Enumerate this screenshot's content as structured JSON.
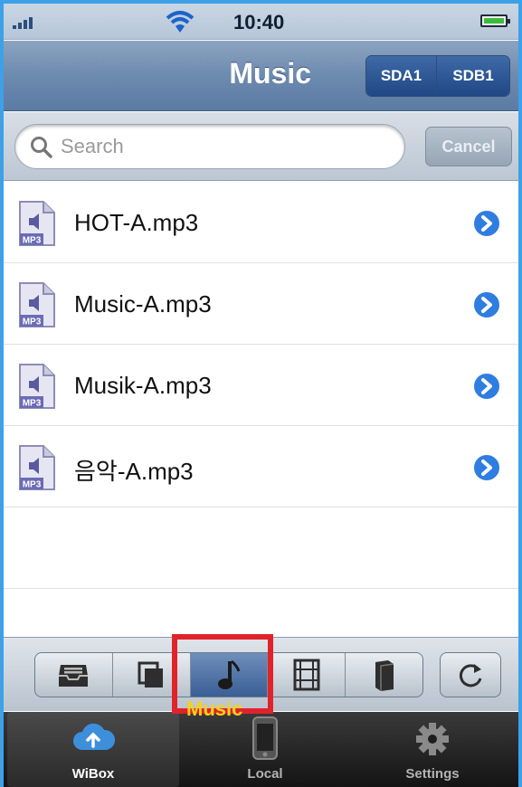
{
  "status_bar": {
    "time": "10:40"
  },
  "nav": {
    "title": "Music",
    "segments": [
      "SDA1",
      "SDB1"
    ]
  },
  "search": {
    "placeholder": "Search",
    "value": "",
    "cancel_label": "Cancel"
  },
  "files": [
    {
      "name": "HOT-A.mp3",
      "icon": "mp3-file-icon",
      "badge": "MP3"
    },
    {
      "name": "Music-A.mp3",
      "icon": "mp3-file-icon",
      "badge": "MP3"
    },
    {
      "name": "Musik-A.mp3",
      "icon": "mp3-file-icon",
      "badge": "MP3"
    },
    {
      "name": "음악-A.mp3",
      "icon": "mp3-file-icon",
      "badge": "MP3"
    }
  ],
  "toolbar": {
    "filters": [
      "inbox-icon",
      "documents-icon",
      "music-note-icon",
      "film-icon",
      "book-icon"
    ],
    "active_filter": "music-note-icon",
    "highlight_label": "Music",
    "highlight_color": "#e0232b"
  },
  "tabs": [
    {
      "label": "WiBox",
      "icon": "cloud-upload-icon",
      "selected": true
    },
    {
      "label": "Local",
      "icon": "iphone-icon",
      "selected": false
    },
    {
      "label": "Settings",
      "icon": "gear-icon",
      "selected": false
    }
  ],
  "colors": {
    "background": "#3ea0e6",
    "nav_blue": "#6d8aaf",
    "disclosure_blue": "#2f7de0"
  }
}
